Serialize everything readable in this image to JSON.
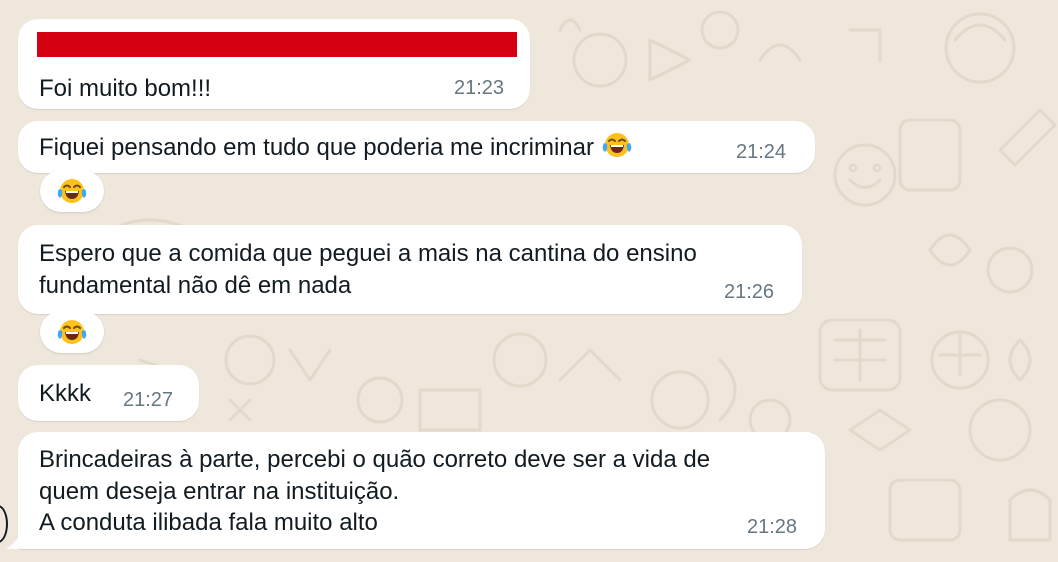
{
  "chat": {
    "messages": [
      {
        "text": "Foi muito bom!!!",
        "time": "21:23",
        "redacted_header": true
      },
      {
        "text": "Fiquei pensando em tudo que poderia me incriminar",
        "time": "21:24",
        "emoji": "face-with-tears-of-joy",
        "reaction": "face-with-tears-of-joy"
      },
      {
        "lines": [
          "Espero que a comida que peguei a mais na cantina do ensino",
          "fundamental não dê em nada"
        ],
        "time": "21:26",
        "reaction": "face-with-tears-of-joy"
      },
      {
        "text": "Kkkk",
        "time": "21:27"
      },
      {
        "lines": [
          "Brincadeiras à parte, percebi o quão correto deve ser a vida de",
          "quem deseja entrar na instituição.",
          "A conduta ilibada fala muito alto"
        ],
        "time": "21:28"
      }
    ]
  },
  "colors": {
    "wallpaper": "#efe7dc",
    "bubble": "#ffffff",
    "text": "#111b21",
    "timestamp": "#667781",
    "redaction": "#d50010"
  }
}
